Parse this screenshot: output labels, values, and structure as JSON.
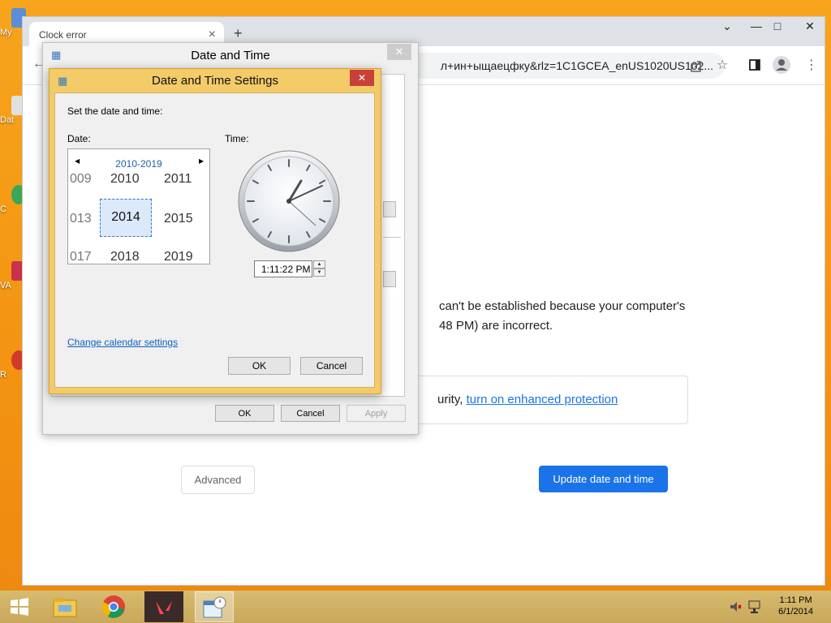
{
  "desktop": {
    "icons": [
      "My",
      "Dat",
      "C",
      "VA",
      "R"
    ]
  },
  "browser": {
    "tab_title": "Clock error",
    "tab_close": "×",
    "new_tab": "+",
    "window_controls": [
      "⌄",
      "—",
      "□",
      "✕"
    ],
    "omnibox_text": "л+ин+ыщаецфку&rlz=1C1GCEA_enUS1020US102...",
    "toolbar_icons": [
      "share-icon",
      "star-icon",
      "sidebar-icon",
      "profile-icon",
      "menu-icon"
    ],
    "error_line1": "can't be established because your computer's",
    "error_line2": "48 PM) are incorrect.",
    "enhanced_prefix": "urity, ",
    "enhanced_link": "turn on enhanced protection",
    "advanced_label": "Advanced",
    "update_label": "Update date and time",
    "accent": "#1a73e8"
  },
  "outer_dialog": {
    "title": "Date and Time",
    "close": "✕",
    "ok_label": "OK",
    "cancel_label": "Cancel",
    "apply_label": "Apply"
  },
  "inner_dialog": {
    "title": "Date and Time Settings",
    "close": "✕",
    "heading": "Set the date and time:",
    "date_label": "Date:",
    "time_label": "Time:",
    "calendar": {
      "range": "2010-2019",
      "prev": "◀",
      "next": "▶",
      "years": [
        "009",
        "2010",
        "2011",
        "013",
        "2014",
        "2015",
        "017",
        "2018",
        "2019"
      ],
      "selected": "2014"
    },
    "time_value": "1:11:22 PM",
    "spin_up": "▲",
    "spin_down": "▼",
    "change_calendar": "Change calendar settings",
    "ok_label": "OK",
    "cancel_label": "Cancel",
    "title_color": "#f3cb68"
  },
  "taskbar": {
    "items": [
      "start-icon",
      "file-explorer-icon",
      "chrome-icon",
      "valorant-icon",
      "date-time-icon"
    ],
    "time": "1:11 PM",
    "date": "6/1/2014"
  }
}
